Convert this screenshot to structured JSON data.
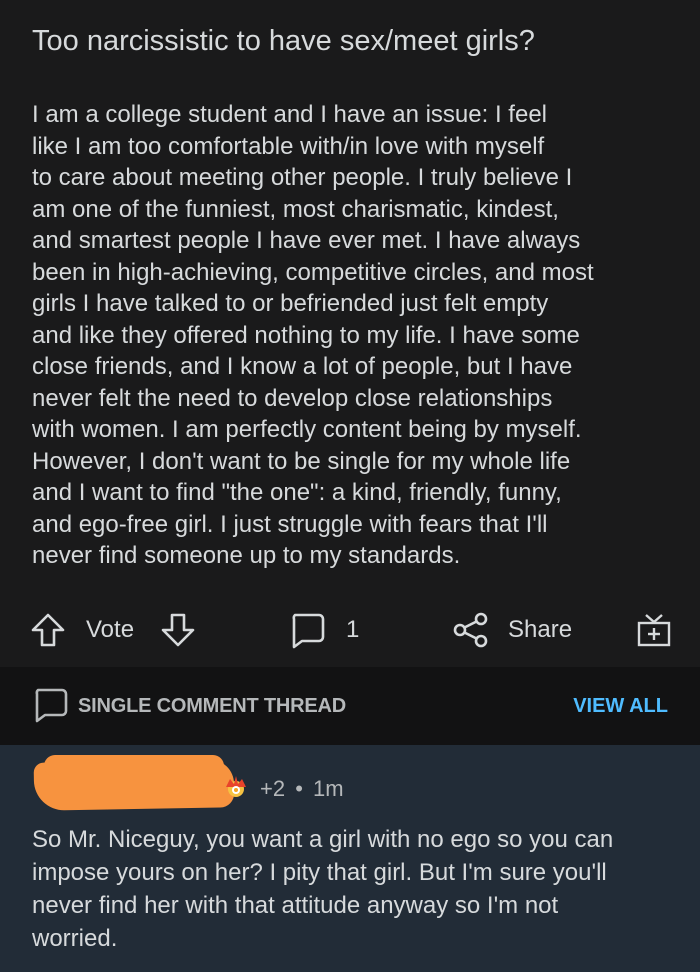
{
  "post": {
    "title": "Too narcissistic to have sex/meet girls?",
    "body_lines": [
      "I am a college student and I have an issue: I feel",
      "like I am too comfortable with/in love with myself",
      "to care about meeting other people. I truly believe I",
      "am one of the funniest, most charismatic, kindest,",
      "and smartest people I have ever met. I have always",
      "been in high-achieving, competitive circles, and most",
      "girls I have talked to or befriended just felt empty",
      "and like they offered nothing to my life. I have some",
      "close friends, and I know a lot of people, but I have",
      "never felt the need to develop close relationships",
      "with women. I am perfectly content being by myself.",
      "However, I don't want to be single for my whole life",
      "and I want to find \"the one\": a kind, friendly, funny,",
      "and ego-free girl. I just struggle with fears that I'll",
      "never find someone up to my standards."
    ]
  },
  "actions": {
    "vote_label": "Vote",
    "comment_count": "1",
    "share_label": "Share"
  },
  "thread": {
    "label": "SINGLE COMMENT THREAD",
    "view_all": "VIEW ALL"
  },
  "comment": {
    "score": "+2",
    "separator": "•",
    "age": "1m",
    "body_lines": [
      "So Mr. Niceguy, you want a girl with no ego so you can",
      "impose yours on her? I pity that girl. But I'm sure you'll",
      "never find her with that attitude anyway so I'm not",
      "worried."
    ]
  },
  "colors": {
    "background": "#1a1a1b",
    "thread_bar": "#121213",
    "comment_bg": "#222c37",
    "text": "#d7dadc",
    "link": "#4fbcff",
    "redaction": "#f7933f"
  },
  "icons": [
    "arrow-up-icon",
    "arrow-down-icon",
    "comment-bubble-icon",
    "share-icon",
    "gift-icon",
    "award-icon"
  ]
}
